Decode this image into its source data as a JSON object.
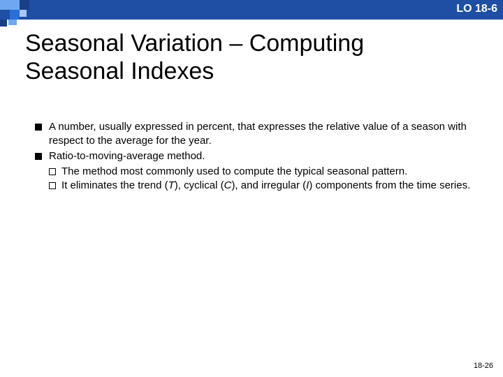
{
  "lo_label": "LO 18-6",
  "title_line1": "Seasonal Variation – Computing",
  "title_line2": "Seasonal Indexes",
  "bullets": {
    "b1": "A number, usually expressed in percent, that expresses the relative value of a season with respect to the average for the year.",
    "b2": "Ratio-to-moving-average method.",
    "s1": "The method most commonly used to compute the typical seasonal pattern.",
    "s2a": "It eliminates the trend (",
    "s2T": "T",
    "s2b": "), cyclical (",
    "s2C": "C",
    "s2c": "), and irregular (",
    "s2I": "I",
    "s2d": ") components from the time series."
  },
  "pagenum": "18-26"
}
